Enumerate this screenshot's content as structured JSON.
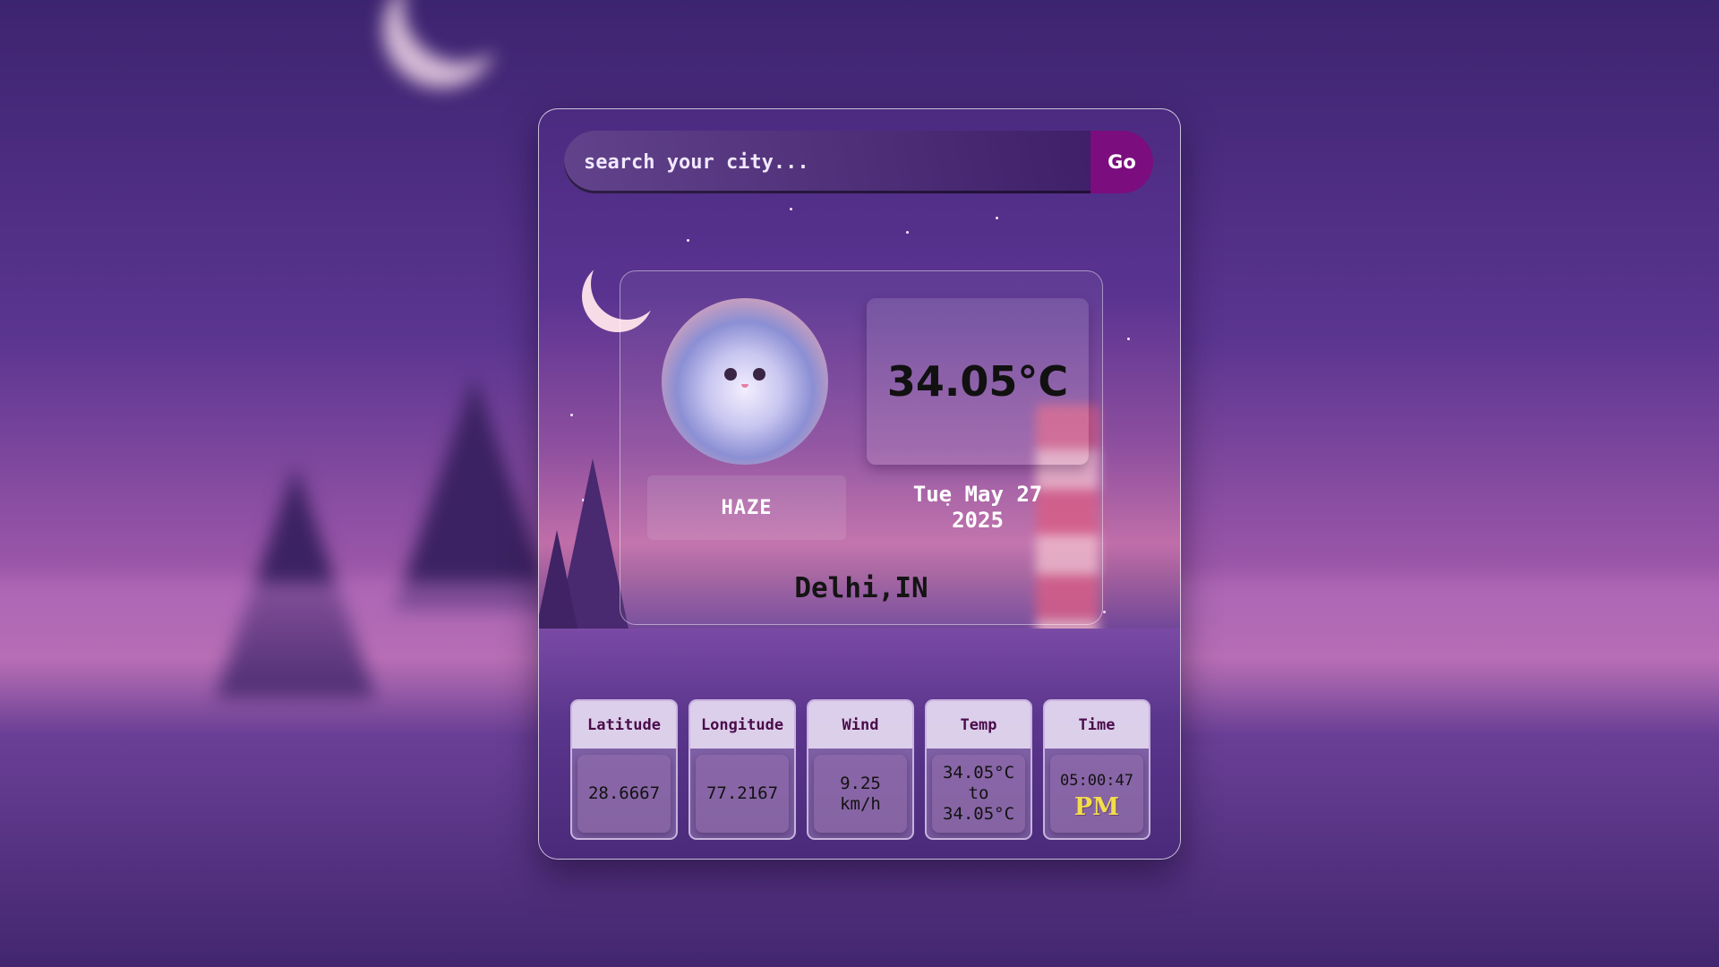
{
  "search": {
    "placeholder": "search your city...",
    "button_label": "Go"
  },
  "weather": {
    "condition": "HAZE",
    "temperature": "34.05°C",
    "date_line1": "Tue May 27",
    "date_line2": "2025",
    "location": "Delhi,IN"
  },
  "stats": {
    "latitude": {
      "label": "Latitude",
      "value": "28.6667"
    },
    "longitude": {
      "label": "Longitude",
      "value": "77.2167"
    },
    "wind": {
      "label": "Wind",
      "value_line1": "9.25",
      "value_line2": "km/h"
    },
    "temp": {
      "label": "Temp",
      "min": "34.05°C",
      "to": "to",
      "max": "34.05°C"
    },
    "time": {
      "label": "Time",
      "value": "05:00:47",
      "ampm": "PM"
    }
  },
  "icons": {
    "weather_image": "haze-cloud-icon"
  },
  "colors": {
    "go_button": "#7b0d7e",
    "ampm": "#f3dd4a",
    "stat_header_text": "#4a0c4a"
  }
}
